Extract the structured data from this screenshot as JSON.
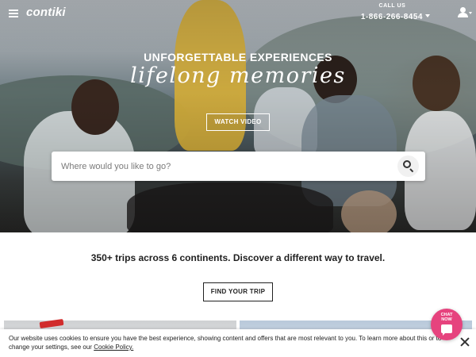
{
  "header": {
    "logo_text": "contiki",
    "call_label": "CALL US",
    "phone": "1-866-266-8454"
  },
  "hero": {
    "headline": "UNFORGETTABLE EXPERIENCES",
    "script_text": "lifelong memories",
    "watch_video_label": "WATCH VIDEO"
  },
  "search": {
    "placeholder": "Where would you like to go?"
  },
  "main": {
    "tagline": "350+ trips across 6 continents. Discover a different way to travel.",
    "find_trip_label": "FIND YOUR TRIP"
  },
  "cookie": {
    "text": "Our website uses cookies to ensure you have the best experience, showing content and offers that are most relevant to you. To learn more about this or to change your settings, see our",
    "link_text": "Cookie Policy."
  },
  "chat": {
    "label_line1": "CHAT",
    "label_line2": "NOW"
  },
  "colors": {
    "chat_accent": "#e6437e"
  },
  "icons": [
    "menu-icon",
    "user-icon",
    "search-icon",
    "chat-icon",
    "close-icon",
    "caret-down-icon"
  ]
}
